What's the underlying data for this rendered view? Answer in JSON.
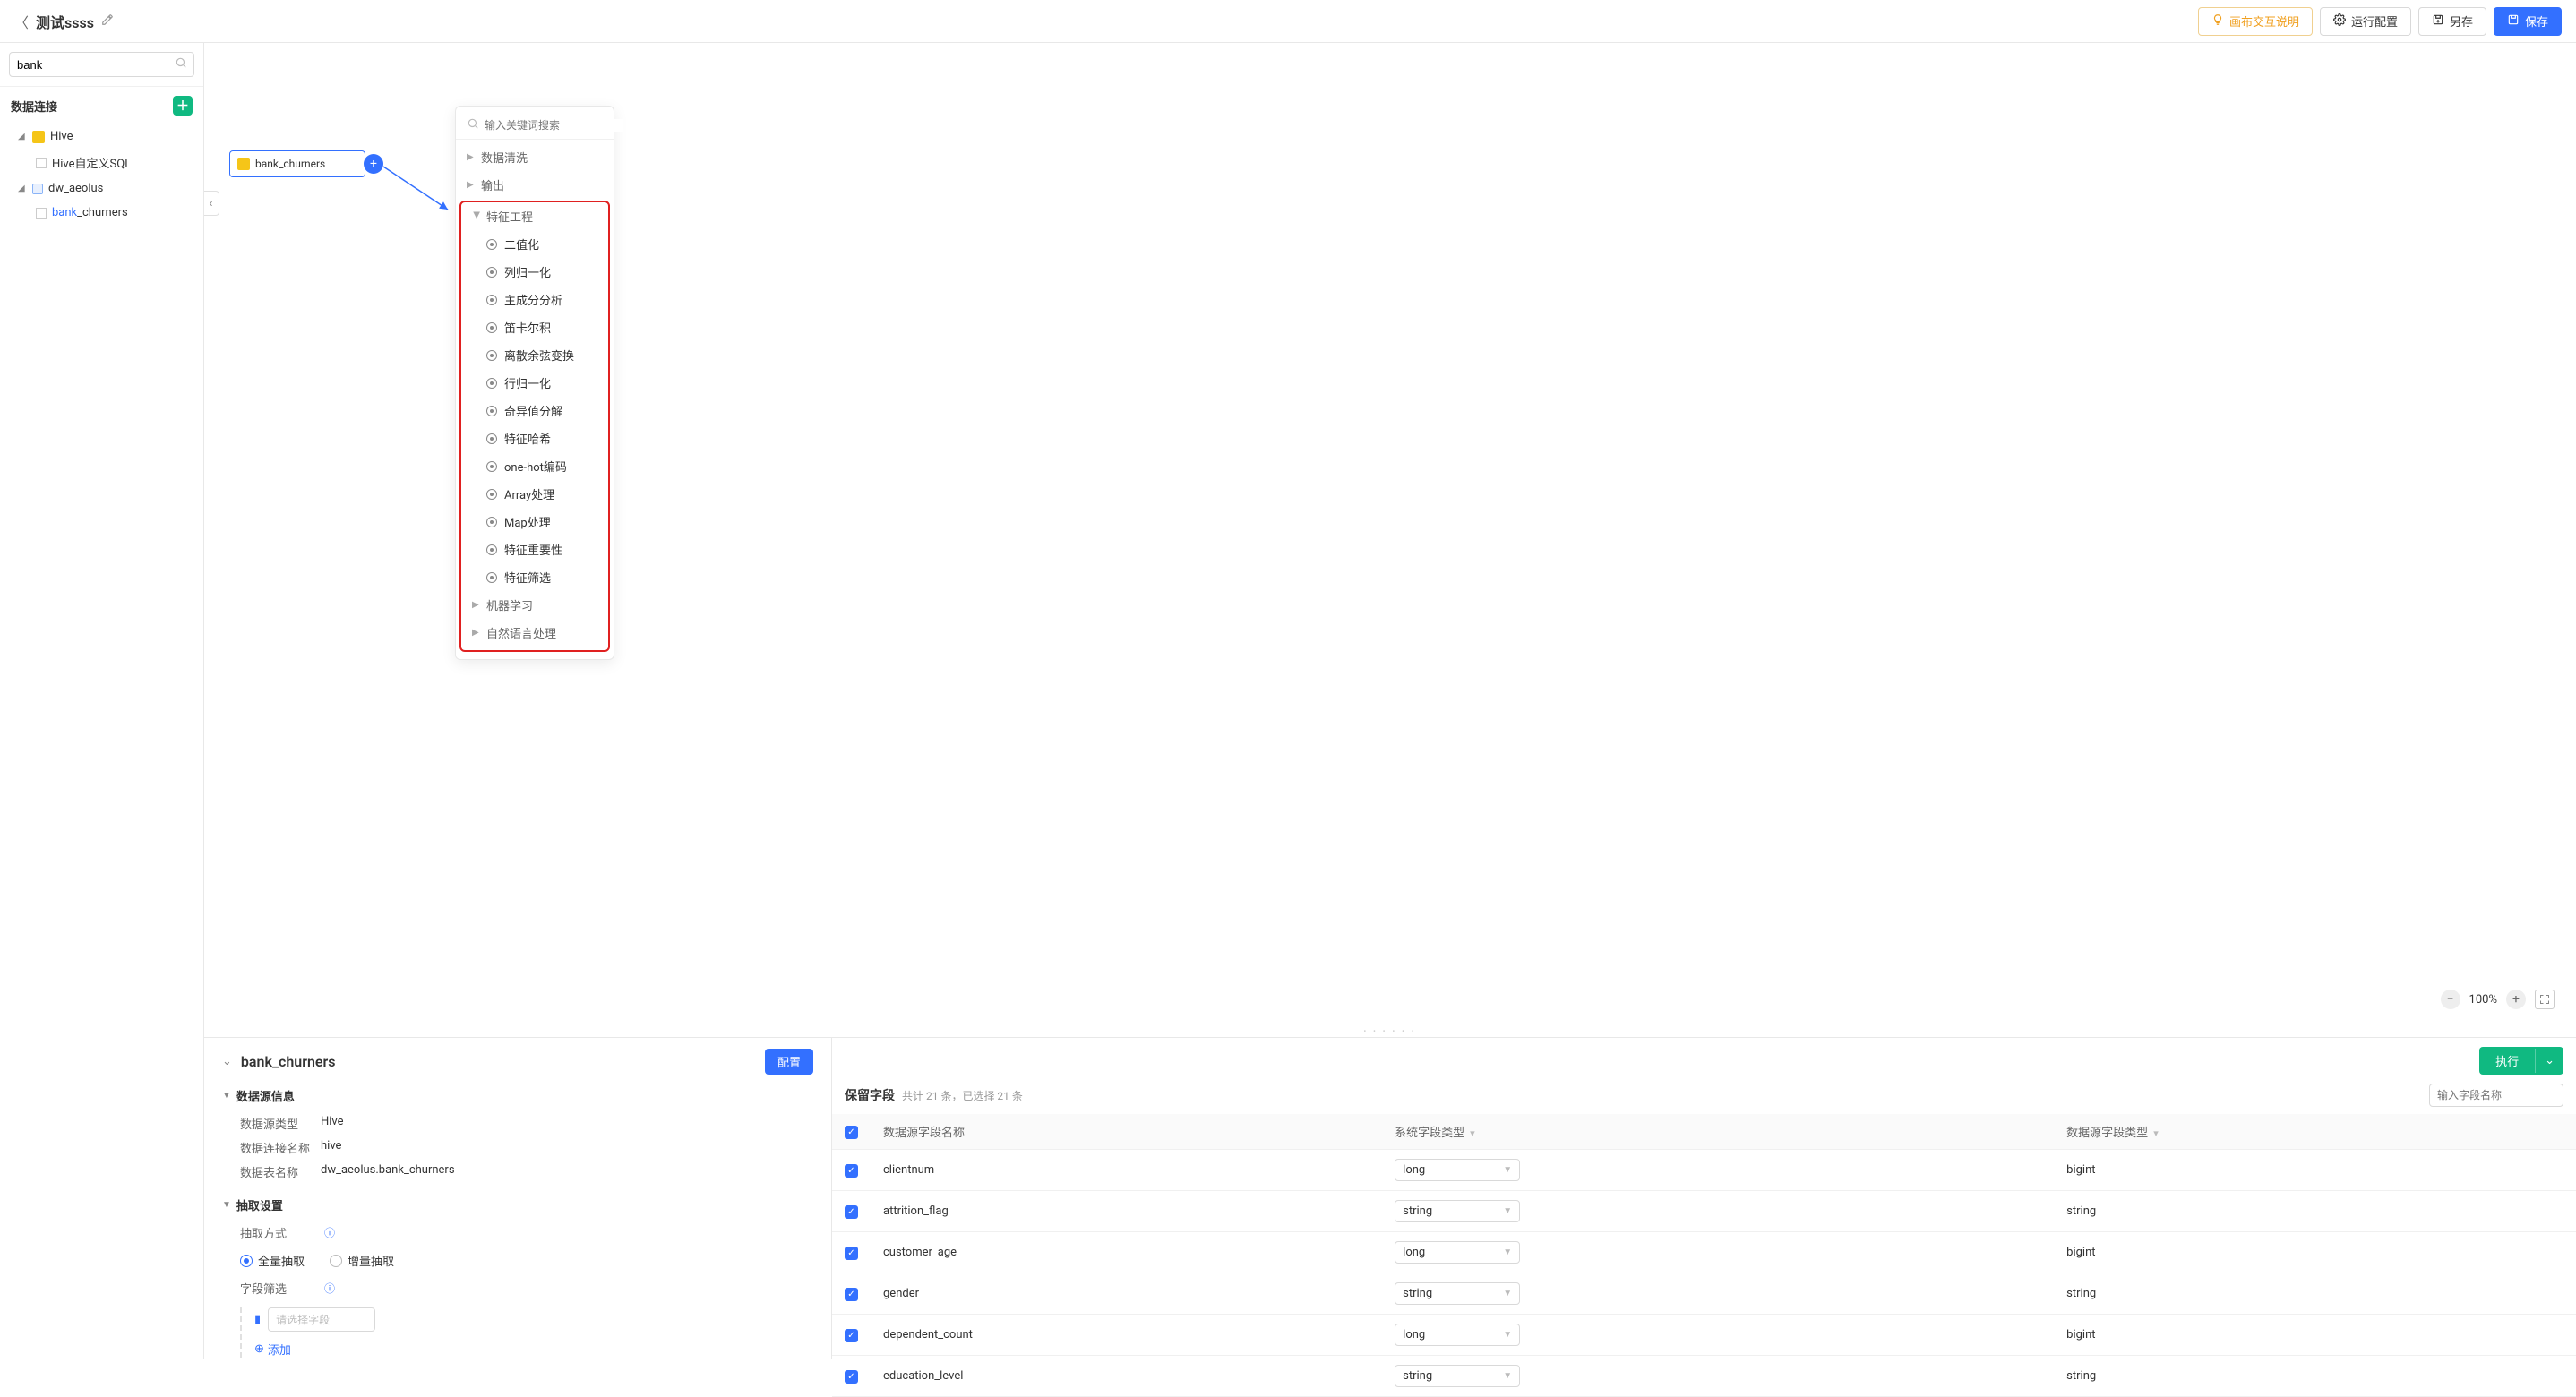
{
  "header": {
    "title": "测试ssss",
    "help": "画布交互说明",
    "run_config": "运行配置",
    "save_as": "另存",
    "save": "保存"
  },
  "left_panel": {
    "search_value": "bank",
    "section_title": "数据连接",
    "tree": {
      "hive_label": "Hive",
      "hive_sql_label": "Hive自定义SQL",
      "db_label": "dw_aeolus",
      "table_prefix": "bank",
      "table_suffix": "_churners"
    }
  },
  "canvas": {
    "node_label": "bank_churners",
    "zoom_text": "100%"
  },
  "popover": {
    "search_placeholder": "输入关键词搜索",
    "groups": {
      "cleaning": "数据清洗",
      "output": "输出",
      "feature": "特征工程",
      "ml": "机器学习",
      "nlp": "自然语言处理"
    },
    "feature_items": [
      "二值化",
      "列归一化",
      "主成分分析",
      "笛卡尔积",
      "离散余弦变换",
      "行归一化",
      "奇异值分解",
      "特征哈希",
      "one-hot编码",
      "Array处理",
      "Map处理",
      "特征重要性",
      "特征筛选"
    ]
  },
  "detail": {
    "title": "bank_churners",
    "config_btn": "配置",
    "section_datasource": "数据源信息",
    "ds_type_k": "数据源类型",
    "ds_type_v": "Hive",
    "conn_k": "数据连接名称",
    "conn_v": "hive",
    "table_k": "数据表名称",
    "table_v": "dw_aeolus.bank_churners",
    "section_extract": "抽取设置",
    "extract_mode_label": "抽取方式",
    "radio_full": "全量抽取",
    "radio_incr": "增量抽取",
    "field_filter_label": "字段筛选",
    "ff_placeholder": "请选择字段",
    "add_label": "添加"
  },
  "run_button": "执行",
  "fields": {
    "title": "保留字段",
    "summary": "共计 21 条，已选择 21 条",
    "search_placeholder": "输入字段名称",
    "col_name": "数据源字段名称",
    "col_systype": "系统字段类型",
    "col_srctype": "数据源字段类型",
    "rows": [
      {
        "name": "clientnum",
        "systype": "long",
        "srctype": "bigint"
      },
      {
        "name": "attrition_flag",
        "systype": "string",
        "srctype": "string"
      },
      {
        "name": "customer_age",
        "systype": "long",
        "srctype": "bigint"
      },
      {
        "name": "gender",
        "systype": "string",
        "srctype": "string"
      },
      {
        "name": "dependent_count",
        "systype": "long",
        "srctype": "bigint"
      },
      {
        "name": "education_level",
        "systype": "string",
        "srctype": "string"
      }
    ]
  }
}
